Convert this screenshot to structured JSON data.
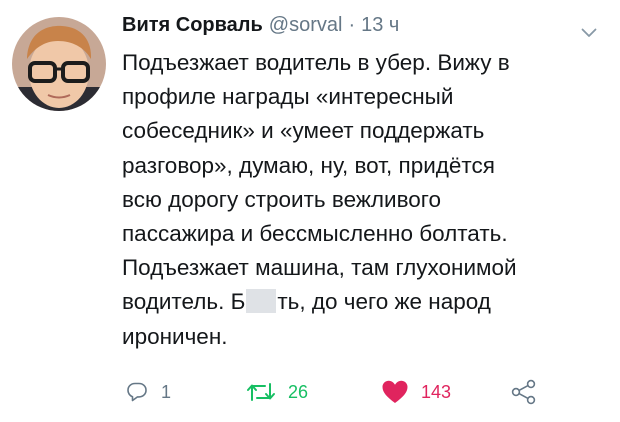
{
  "tweet": {
    "author_name": "Витя Сорваль",
    "handle": "@sorval",
    "separator": "·",
    "time": "13 ч",
    "lines": {
      "l1": "Подъезжает водитель в убер. Вижу в",
      "l2": "профиле награды «интересный",
      "l3": "собеседник» и «умеет поддержать",
      "l4": "разговор», думаю, ну, вот, придётся",
      "l5": "всю дорогу строить вежливого",
      "l6": "пассажира и бессмысленно болтать.",
      "l7": "Подъезжает машина, там глухонимой",
      "l8a": "водитель. Б",
      "l8b": "ть, до чего же народ",
      "l9": "ироничен."
    }
  },
  "actions": {
    "reply_count": "1",
    "retweet_count": "26",
    "like_count": "143"
  },
  "icons": {
    "caret": "chevron-down-icon",
    "reply": "reply-icon",
    "retweet": "retweet-icon",
    "like": "heart-icon",
    "share": "share-icon"
  },
  "colors": {
    "text": "#14171a",
    "secondary": "#657786",
    "retweet_green": "#17bf63",
    "like_red": "#e0245e"
  }
}
